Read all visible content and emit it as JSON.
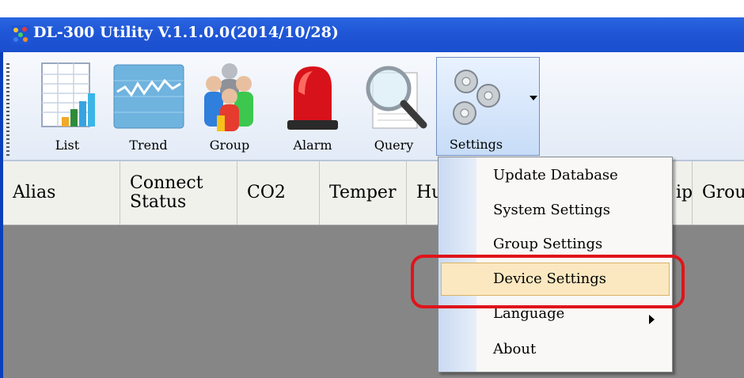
{
  "window": {
    "title": "DL-300 Utility V.1.1.0.0(2014/10/28)"
  },
  "toolbar": {
    "buttons": [
      {
        "label": "List",
        "icon": "list-icon"
      },
      {
        "label": "Trend",
        "icon": "trend-icon"
      },
      {
        "label": "Group",
        "icon": "group-icon"
      },
      {
        "label": "Alarm",
        "icon": "alarm-icon"
      },
      {
        "label": "Query",
        "icon": "query-icon"
      },
      {
        "label": "Settings",
        "icon": "gears-icon"
      }
    ]
  },
  "grid": {
    "columns": [
      "Alias",
      "Connect Status",
      "CO2",
      "Temper",
      "Hu",
      "ip",
      "Grou"
    ]
  },
  "settings_menu": {
    "items": [
      {
        "label": "Update Database"
      },
      {
        "label": "System Settings"
      },
      {
        "label": "Group Settings"
      },
      {
        "label": "Device Settings",
        "highlighted": true
      },
      {
        "label": "Language",
        "has_submenu": true
      },
      {
        "label": "About"
      }
    ]
  },
  "colors": {
    "titlebar": "#1f56d6",
    "highlight": "#fbe8c0",
    "callout": "#e0141a",
    "grid_body": "#868686"
  }
}
